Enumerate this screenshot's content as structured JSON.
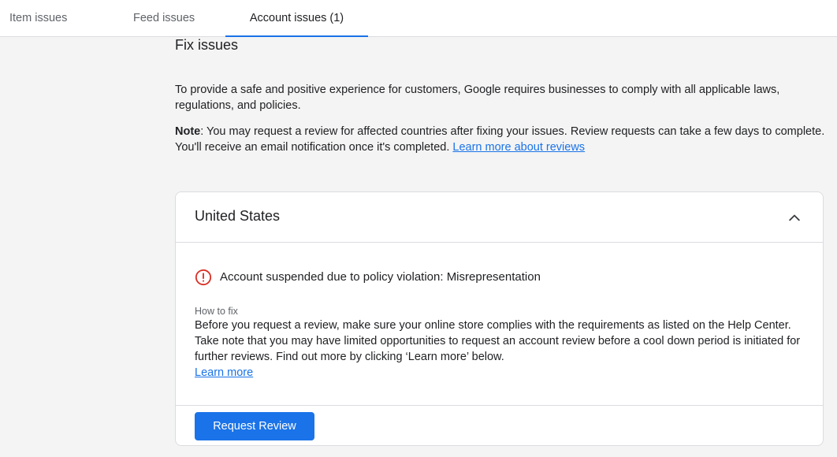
{
  "tabs": [
    {
      "label": "Item issues",
      "active": false
    },
    {
      "label": "Feed issues",
      "active": false
    },
    {
      "label": "Account issues (1)",
      "active": true
    }
  ],
  "section": {
    "title": "Fix issues",
    "intro": "To provide a safe and positive experience for customers, Google requires businesses to comply with all applicable laws, regulations, and policies.",
    "note_label": "Note",
    "note_text": ": You may request a review for affected countries after fixing your issues. Review requests can take a few days to complete. You'll receive an email notification once it's completed.",
    "note_link": "Learn more about reviews"
  },
  "card": {
    "country": "United States",
    "expand_icon": "chevron-up-icon",
    "issue": {
      "icon": "error-icon",
      "title": "Account suspended due to policy violation: Misrepresentation"
    },
    "how_to_fix_label": "How to fix",
    "how_to_fix_text": "Before you request a review, make sure your online store complies with the requirements as listed on the Help Center. Take note that you may have limited opportunities to request an account review before a cool down period is initiated for further reviews. Find out more by clicking ‘Learn more’ below.",
    "learn_more": "Learn more",
    "request_button": "Request Review"
  },
  "colors": {
    "accent": "#1a73e8",
    "error": "#d93025",
    "background": "#f4f4f4"
  }
}
